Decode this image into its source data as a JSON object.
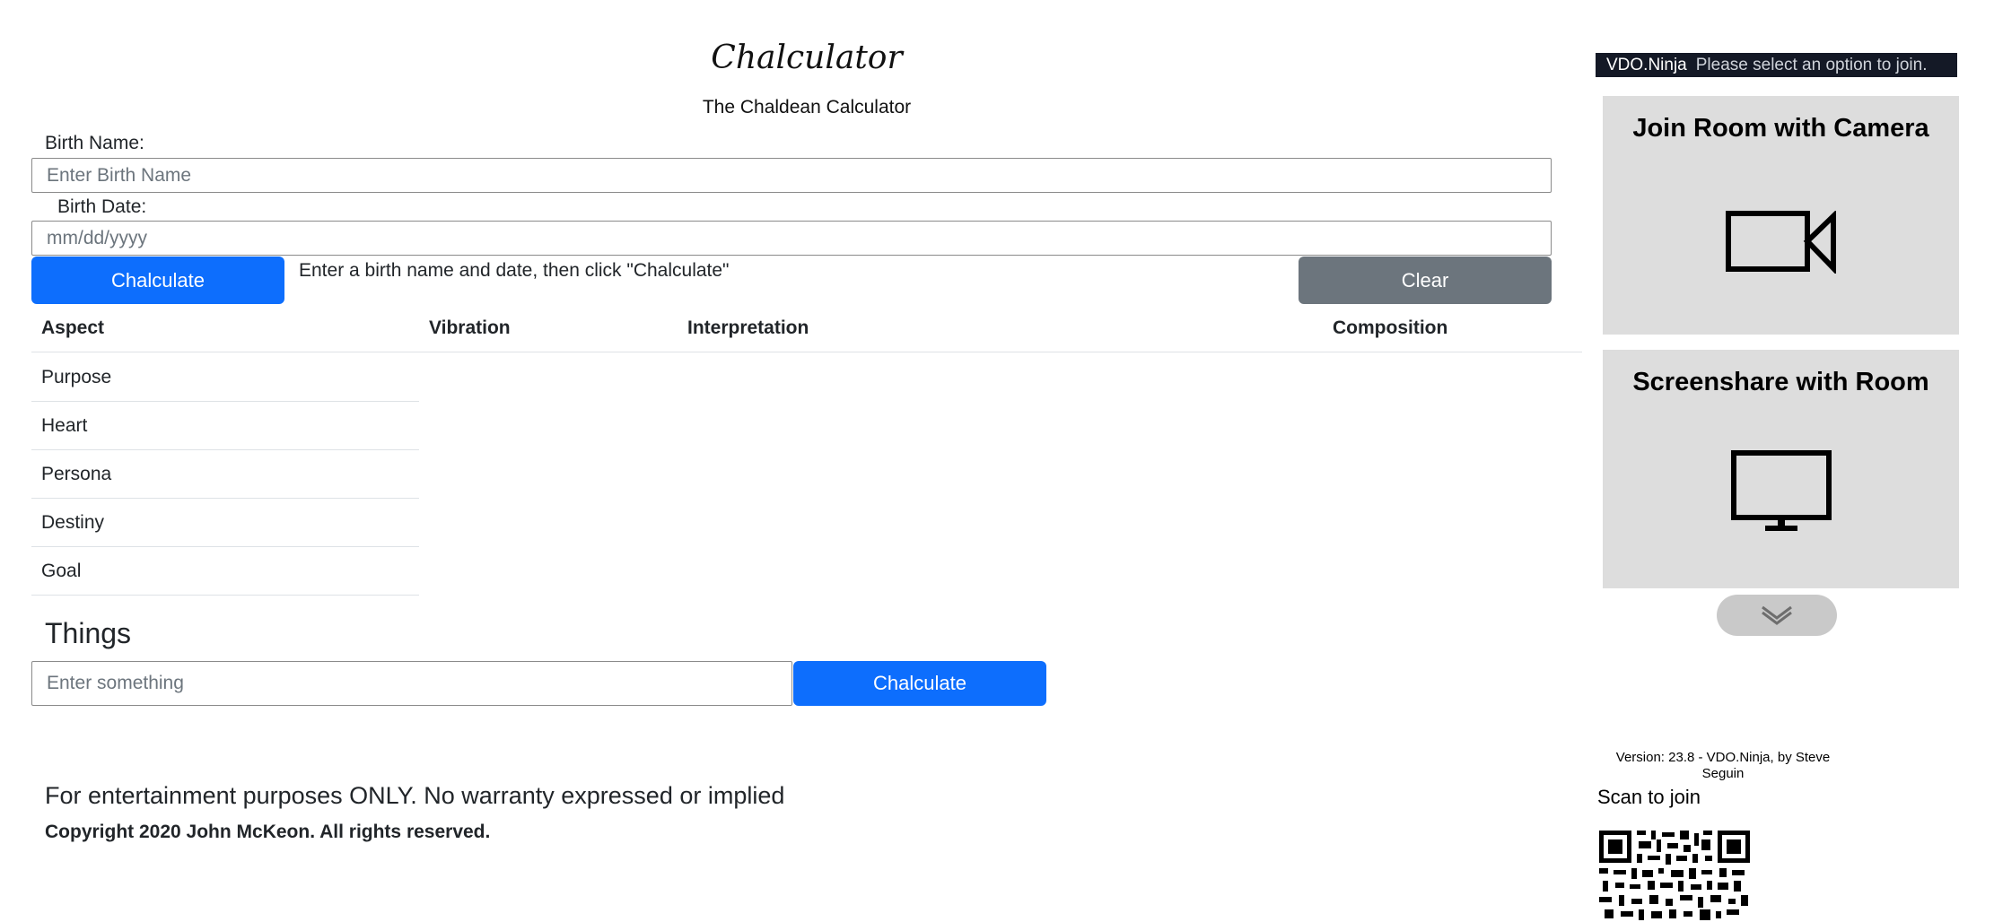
{
  "calculator": {
    "title": "Chalculator",
    "subtitle": "The Chaldean Calculator",
    "birth_name_label": "Birth Name:",
    "birth_name_placeholder": "Enter Birth Name",
    "birth_name_value": "",
    "birth_date_label": "Birth Date:",
    "birth_date_placeholder": "mm/dd/yyyy",
    "birth_date_value": "",
    "chalculate_label": "Chalculate",
    "instructions": "Enter a birth name and date, then click \"Chalculate\"",
    "clear_label": "Clear"
  },
  "results_table": {
    "headers": [
      "Aspect",
      "Vibration",
      "Interpretation",
      "Composition"
    ],
    "rows": [
      {
        "aspect": "Purpose"
      },
      {
        "aspect": "Heart"
      },
      {
        "aspect": "Persona"
      },
      {
        "aspect": "Destiny"
      },
      {
        "aspect": "Goal"
      }
    ]
  },
  "things": {
    "heading": "Things",
    "input_placeholder": "Enter something",
    "input_value": "",
    "chalculate_label": "Chalculate"
  },
  "footer": {
    "disclaimer": "For entertainment purposes ONLY. No warranty expressed or implied",
    "copyright": "Copyright 2020 John McKeon. All rights reserved."
  },
  "vdo_panel": {
    "brand": "VDO.Ninja",
    "message": "Please select an option to join.",
    "join_camera_label": "Join Room with Camera",
    "join_camera_icon": "video-camera-icon",
    "screenshare_label": "Screenshare with Room",
    "screenshare_icon": "monitor-icon",
    "more_icon": "chevron-double-down-icon",
    "version": "Version: 23.8 - VDO.Ninja, by Steve Seguin",
    "scan_to_join": "Scan to join",
    "qr_icon": "qr-code"
  },
  "colors": {
    "primary_button": "#0d6efd",
    "secondary_button": "#6c757d",
    "vdo_bar": "#141926",
    "card_background": "#dddddd"
  }
}
